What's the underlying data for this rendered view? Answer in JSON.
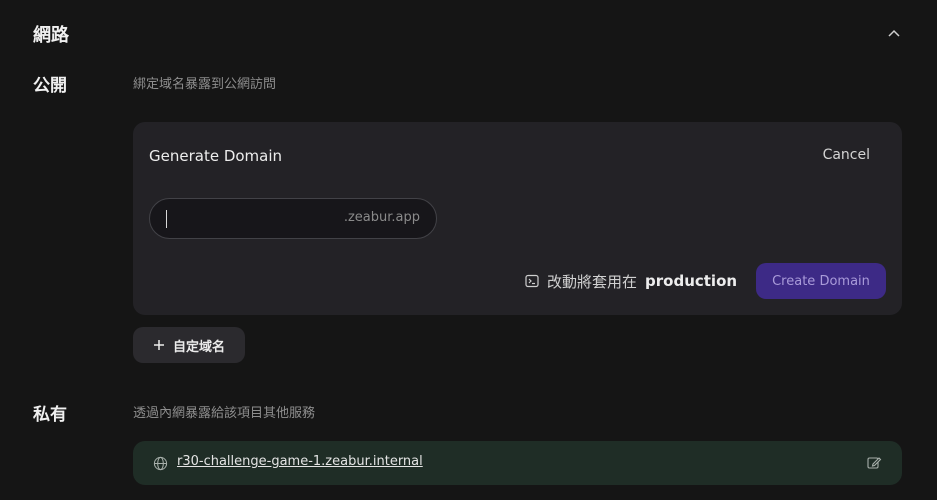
{
  "section": {
    "title": "網路"
  },
  "public": {
    "label": "公開",
    "description": "綁定域名暴露到公網訪問",
    "card": {
      "title": "Generate Domain",
      "cancel_label": "Cancel",
      "input_value": "",
      "domain_suffix": ".zeabur.app",
      "env_note_prefix": "改動將套用在",
      "env_name": "production",
      "create_label": "Create Domain"
    },
    "custom_domain_label": "自定域名"
  },
  "private": {
    "label": "私有",
    "description": "透過內網暴露給該項目其他服務",
    "internal_host": "r30-challenge-game-1.zeabur.internal"
  },
  "colors": {
    "background": "#151515",
    "card": "#232226",
    "primary_button": "#3d2a86",
    "internal_bar": "#1f2d26"
  },
  "icons": [
    "chevron-up-icon",
    "terminal-icon",
    "plus-icon",
    "globe-icon",
    "edit-icon"
  ]
}
